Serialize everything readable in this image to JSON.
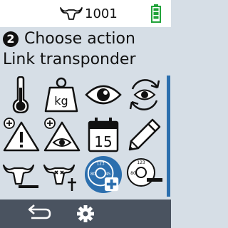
{
  "status_bar": {
    "animal_number": "1001",
    "animal_icon": "cow-head-icon",
    "battery_icon": "battery-full-icon",
    "battery_color": "#21a33a"
  },
  "header": {
    "step_number": "2",
    "title": "Choose action",
    "subtitle": "Link transponder"
  },
  "actions": [
    {
      "icon": "thermometer-icon"
    },
    {
      "icon": "weight-kg-icon",
      "label": "kg"
    },
    {
      "icon": "eye-icon"
    },
    {
      "icon": "eye-recheck-icon"
    },
    {
      "icon": "warning-plus-icon"
    },
    {
      "icon": "eye-triangle-plus-icon"
    },
    {
      "icon": "calendar-icon",
      "label": "15"
    },
    {
      "icon": "pencil-icon"
    },
    {
      "icon": "animal-remove-icon"
    },
    {
      "icon": "animal-dead-icon"
    },
    {
      "icon": "transponder-add-icon",
      "selected": true,
      "digits": "1 2 3 4 5 6 7 8 0"
    },
    {
      "icon": "transponder-remove-icon",
      "digits": "1 2 3 4 5 6 7 8 0"
    }
  ],
  "colors": {
    "background": "#d6dee6",
    "selected": "#2c6fae",
    "bottom_bar": "#4a5360"
  },
  "bottom_bar": {
    "back_icon": "back-arrow-icon",
    "settings_icon": "gear-icon"
  }
}
